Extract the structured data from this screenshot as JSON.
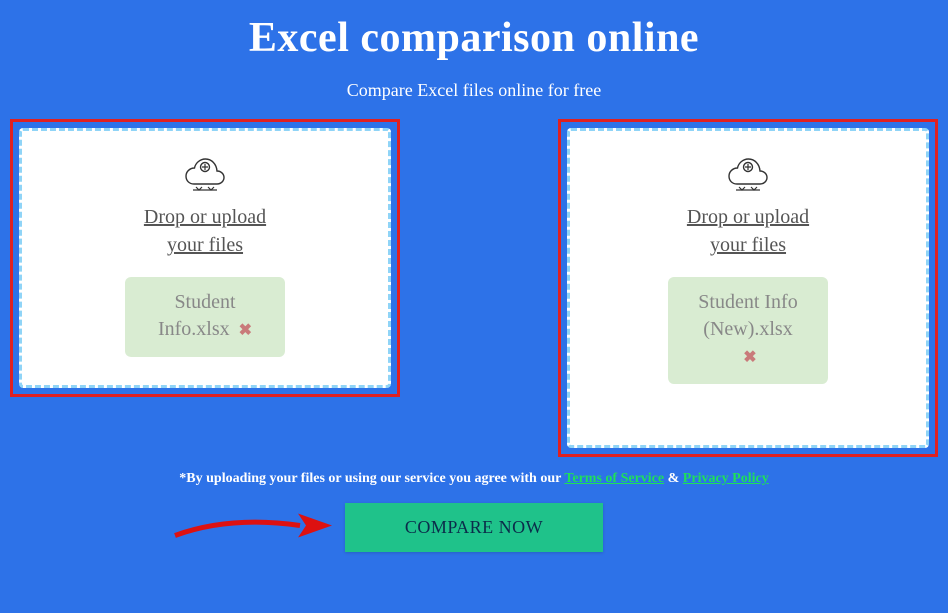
{
  "title": "Excel comparison online",
  "subtitle": "Compare Excel files online for free",
  "drop": {
    "label_line1": "Drop or upload",
    "label_line2": "your files"
  },
  "files": {
    "left": "Student Info.xlsx",
    "right": "Student Info (New).xlsx"
  },
  "disclaimer": {
    "prefix": "*By uploading your files or using our service you agree with our ",
    "tos": "Terms of Service",
    "amp": " & ",
    "pp": "Privacy Policy"
  },
  "compare_button": "COMPARE NOW"
}
